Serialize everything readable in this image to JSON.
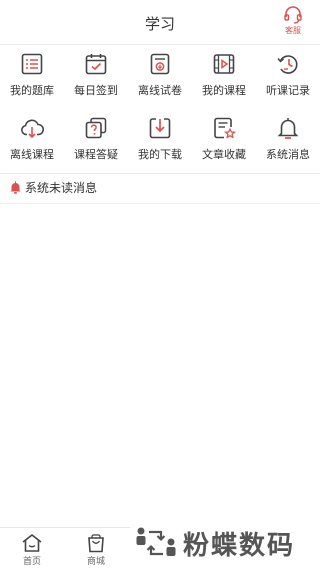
{
  "header": {
    "title": "学习",
    "service_label": "客服"
  },
  "grid": {
    "row1": [
      {
        "label": "我的题库",
        "icon": "list-icon"
      },
      {
        "label": "每日签到",
        "icon": "calendar-check-icon"
      },
      {
        "label": "离线试卷",
        "icon": "offline-paper-icon"
      },
      {
        "label": "我的课程",
        "icon": "video-course-icon"
      },
      {
        "label": "听课记录",
        "icon": "history-icon"
      }
    ],
    "row2": [
      {
        "label": "离线课程",
        "icon": "cloud-download-icon"
      },
      {
        "label": "课程答疑",
        "icon": "question-icon"
      },
      {
        "label": "我的下载",
        "icon": "download-icon"
      },
      {
        "label": "文章收藏",
        "icon": "favorite-doc-icon"
      },
      {
        "label": "系统消息",
        "icon": "bell-icon"
      }
    ]
  },
  "notice": {
    "text": "系统未读消息"
  },
  "tabbar": {
    "home_label": "首页",
    "mall_label": "商城"
  },
  "watermark": {
    "text": "粉蝶数码"
  },
  "colors": {
    "accent": "#d9534f",
    "icon": "#444444"
  }
}
